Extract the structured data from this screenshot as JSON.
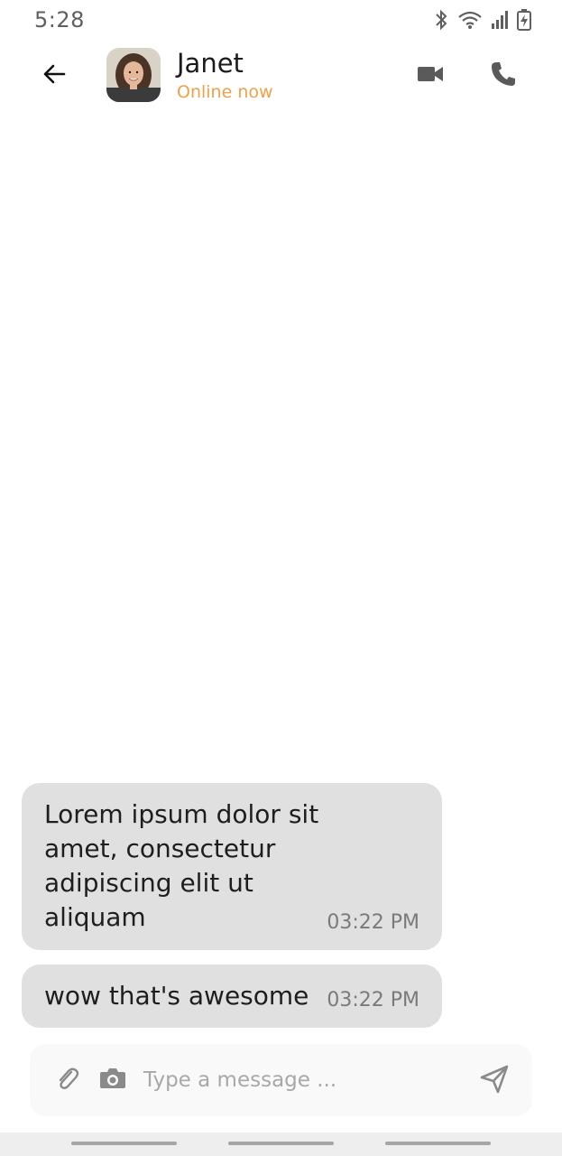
{
  "status_bar": {
    "time": "5:28",
    "icons": [
      "bluetooth-icon",
      "wifi-icon",
      "signal-icon",
      "battery-charging-icon"
    ]
  },
  "header": {
    "back_icon": "arrow-left-icon",
    "contact_name": "Janet",
    "contact_status": "Online now",
    "video_icon": "video-camera-icon",
    "call_icon": "phone-icon"
  },
  "messages": [
    {
      "text": "Lorem ipsum dolor sit amet, consectetur adipiscing elit ut aliquam",
      "time": "03:22 PM"
    },
    {
      "text": "wow that's awesome",
      "time": "03:22 PM"
    }
  ],
  "composer": {
    "placeholder": "Type a message ...",
    "value": "",
    "attach_icon": "paperclip-icon",
    "camera_icon": "camera-icon",
    "send_icon": "send-icon"
  },
  "colors": {
    "accent": "#f0a04b",
    "bubble": "#e0e0e0",
    "icon": "#5f5f5f"
  }
}
